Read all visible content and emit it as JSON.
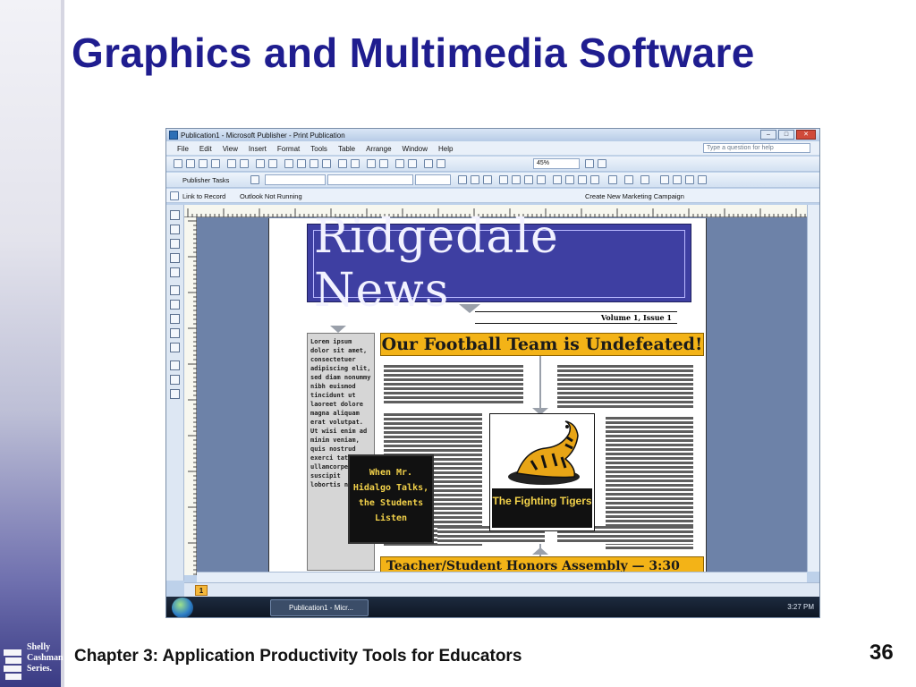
{
  "slide": {
    "title": "Graphics and Multimedia Software",
    "footer": "Chapter 3: Application Productivity Tools for Educators",
    "page_number": "36",
    "logo_lines": [
      "Shelly",
      "Cashman",
      "Series."
    ]
  },
  "window": {
    "title": "Publication1 - Microsoft Publisher - Print Publication",
    "menus": [
      "File",
      "Edit",
      "View",
      "Insert",
      "Format",
      "Tools",
      "Table",
      "Arrange",
      "Window",
      "Help"
    ],
    "help_placeholder": "Type a question for help",
    "zoom": "45%",
    "publisher_tasks": "Publisher Tasks",
    "link_to_record": "Link to Record",
    "outlook_status": "Outlook Not Running",
    "create_campaign": "Create New Marketing Campaign",
    "page_indicator": "1",
    "taskbar_item": "Publication1 - Micr...",
    "clock": "3:27 PM"
  },
  "publication": {
    "masthead": "Ridgedale News",
    "volume": "Volume 1, Issue 1",
    "headline": "Our Football Team is Undefeated!",
    "sidebar_text": "Lorem ipsum dolor sit amet, consectetuer adipiscing elit, sed diam nonummy nibh euismod tincidunt ut laoreet dolore magna aliquam erat volutpat. Ut wisi enim ad minim veniam, quis nostrud exerci tation ullamcorper suscipit lobortis nisl ut",
    "pullquote": "When Mr. Hidalgo Talks, the Students Listen",
    "photo_caption": "The Fighting Tigers",
    "subhead": "Teacher/Student Honors Assembly — 3:30"
  },
  "colors": {
    "title_blue": "#1f1d8f",
    "masthead_blue": "#3e3fa2",
    "headline_gold": "#f3b317"
  }
}
